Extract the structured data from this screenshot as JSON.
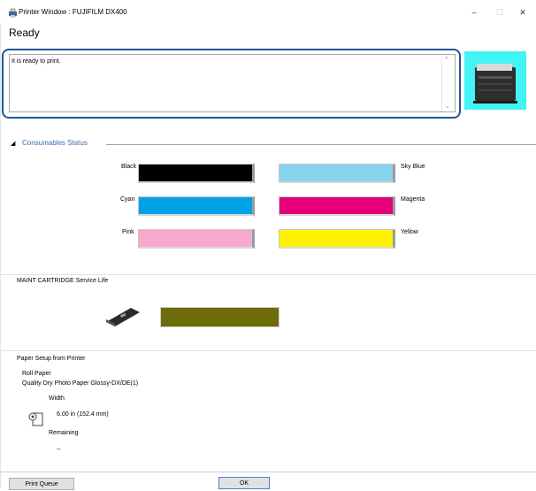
{
  "window": {
    "title": "Printer Window : FUJIFILM DX400",
    "minimize_glyph": "–",
    "maximize_glyph": "☐",
    "close_glyph": "✕"
  },
  "status": {
    "heading": "Ready",
    "message": "It is ready to print."
  },
  "consumables": {
    "toggle_glyph": "◢",
    "title": "Consumables Status",
    "inks": [
      {
        "label": "Black",
        "color": "#000000"
      },
      {
        "label": "Sky Blue",
        "color": "#87d4f0"
      },
      {
        "label": "Cyan",
        "color": "#00a2e6"
      },
      {
        "label": "Magenta",
        "color": "#e3007a"
      },
      {
        "label": "Pink",
        "color": "#f6a9cd"
      },
      {
        "label": "Yellow",
        "color": "#fff200"
      }
    ]
  },
  "maint": {
    "label": "MAINT CARTRIDGE Service Life",
    "bar_color": "#6e6b0b"
  },
  "paper": {
    "heading": "Paper Setup from Printer",
    "type": "Roll Paper",
    "name": "Quality Dry Photo Paper Glossy-DX/DE(1)",
    "width_label": "Width",
    "width_value": "6.00 in (152.4 mm)",
    "remaining_label": "Remaining",
    "remaining_value": "--"
  },
  "buttons": {
    "print_queue": "Print Queue",
    "ok": "OK"
  }
}
